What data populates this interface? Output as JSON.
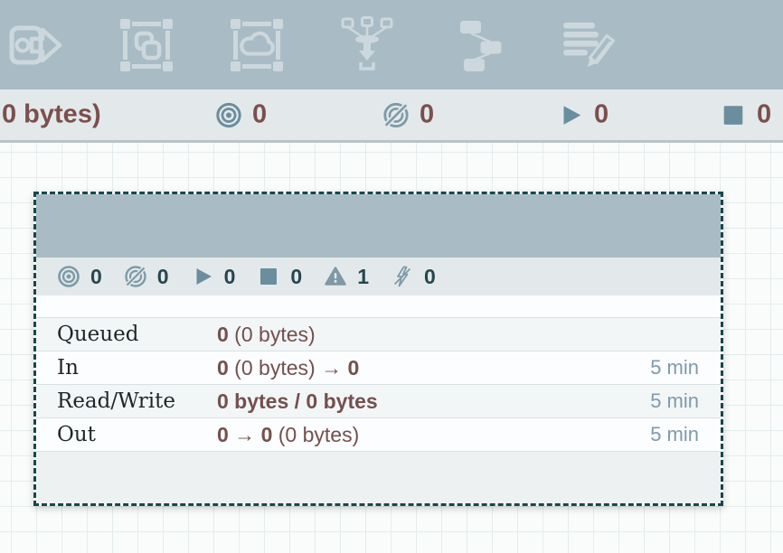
{
  "toolbar": {
    "icon_names": [
      "output-port",
      "process-group",
      "remote-process-group",
      "funnel",
      "template",
      "label"
    ]
  },
  "status_bar": {
    "queued_text_partial": "0 bytes)",
    "transmitting_count": "0",
    "not_transmitting_count": "0",
    "running_count": "0",
    "stopped_count": "0"
  },
  "process_group": {
    "title": "",
    "stats": {
      "transmitting": "0",
      "not_transmitting": "0",
      "running": "0",
      "stopped": "0",
      "invalid": "1",
      "disabled": "0"
    },
    "table": {
      "rows": [
        {
          "label": "Queued",
          "parts": [
            {
              "text": "0",
              "bold": true
            },
            {
              "text": " (0 bytes)",
              "bold": false
            }
          ],
          "time": ""
        },
        {
          "label": "In",
          "parts": [
            {
              "text": "0",
              "bold": true
            },
            {
              "text": " (0 bytes) ",
              "bold": false
            },
            {
              "text": "→ ",
              "bold": true
            },
            {
              "text": "0",
              "bold": true
            }
          ],
          "time": "5 min"
        },
        {
          "label": "Read/Write",
          "parts": [
            {
              "text": "0 bytes / 0 bytes",
              "bold": true
            }
          ],
          "time": "5 min"
        },
        {
          "label": "Out",
          "parts": [
            {
              "text": "0",
              "bold": true
            },
            {
              "text": " → ",
              "bold": true
            },
            {
              "text": "0",
              "bold": true
            },
            {
              "text": " (0 bytes)",
              "bold": false
            }
          ],
          "time": "5 min"
        }
      ]
    }
  },
  "colors": {
    "toolbar_bg": "#a9bcc5",
    "toolbar_icon": "#ccd8dd",
    "statusbar_bg": "#e3e9eb",
    "canvas_bg": "#fafcfc",
    "grid_line": "#e5eced",
    "stat_value_maroon": "#74504e",
    "statusbar_maroon": "#7b4f4d",
    "icon_blue": "#6b8e9e",
    "icon_blue_light": "#7e9aa8",
    "count_teal": "#27464f",
    "time_blue": "#7f9aac",
    "selection_border": "#17474e",
    "row_alt_bg": "#f3f6f7"
  }
}
